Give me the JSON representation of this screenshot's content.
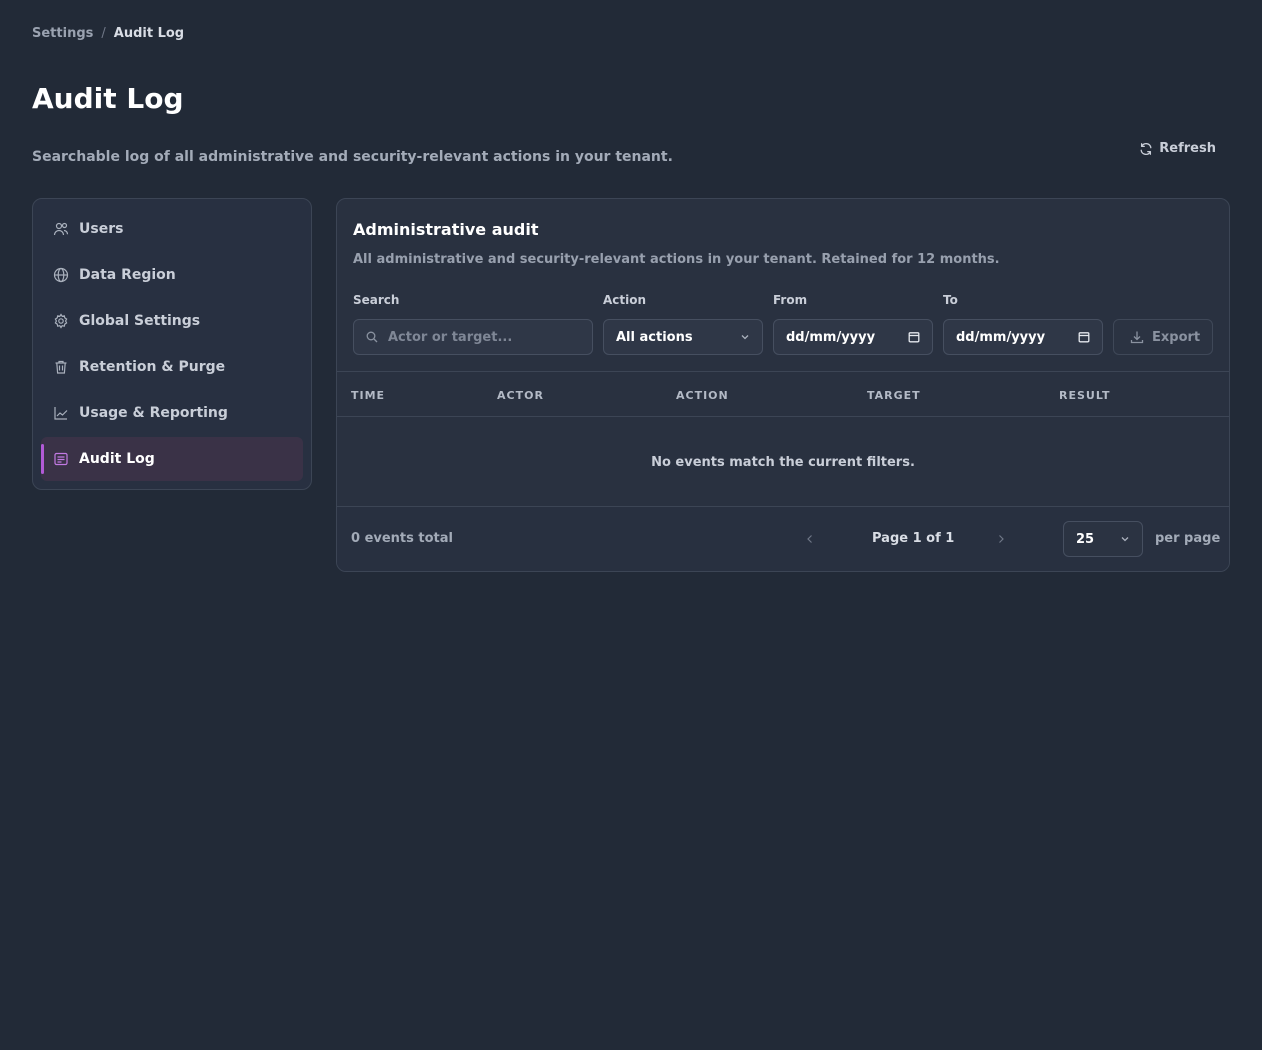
{
  "breadcrumb": {
    "parent": "Settings",
    "separator": "/",
    "current": "Audit Log"
  },
  "page": {
    "title": "Audit Log",
    "subtitle": "Searchable log of all administrative and security-relevant actions in your tenant.",
    "refresh_label": "Refresh"
  },
  "sidebar": {
    "items": [
      {
        "label": "Users",
        "icon": "users-icon",
        "active": false
      },
      {
        "label": "Data Region",
        "icon": "globe-icon",
        "active": false
      },
      {
        "label": "Global Settings",
        "icon": "gear-icon",
        "active": false
      },
      {
        "label": "Retention & Purge",
        "icon": "trash-icon",
        "active": false
      },
      {
        "label": "Usage & Reporting",
        "icon": "chart-icon",
        "active": false
      },
      {
        "label": "Audit Log",
        "icon": "log-icon",
        "active": true
      }
    ]
  },
  "panel": {
    "title": "Administrative audit",
    "description": "All administrative and security-relevant actions in your tenant. Retained for 12 months."
  },
  "filters": {
    "search_label": "Search",
    "search_placeholder": "Actor or target...",
    "action_label": "Action",
    "action_value": "All actions",
    "from_label": "From",
    "from_value": "dd/mm/yyyy",
    "to_label": "To",
    "to_value": "dd/mm/yyyy",
    "export_label": "Export"
  },
  "table": {
    "columns": [
      "TIME",
      "ACTOR",
      "ACTION",
      "TARGET",
      "RESULT"
    ],
    "empty_message": "No events match the current filters."
  },
  "pagination": {
    "total": "0 events total",
    "page_info": "Page 1 of 1",
    "per_page_value": "25",
    "per_page_label": "per page"
  },
  "colors": {
    "background": "#222a37",
    "card": "#293140",
    "accent": "#b25ad6",
    "active_bg": "#3a3247"
  }
}
